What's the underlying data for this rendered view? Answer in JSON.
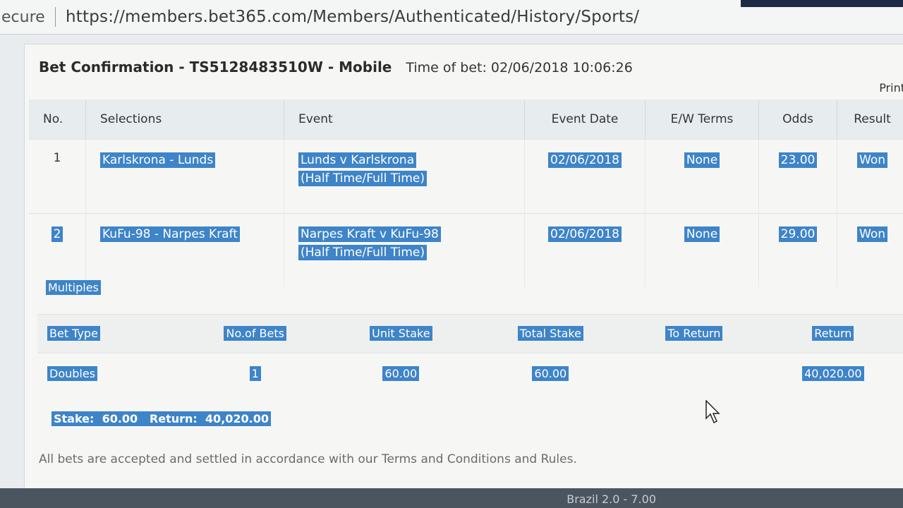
{
  "browser": {
    "secure_label": "ecure",
    "url": "https://members.bet365.com/Members/Authenticated/History/Sports/"
  },
  "header": {
    "title": "Bet Confirmation - TS5128483510W - Mobile",
    "time_of_bet": "Time of bet: 02/06/2018 10:06:26",
    "print_label": "Print"
  },
  "selections_table": {
    "columns": [
      "No.",
      "Selections",
      "Event",
      "Event Date",
      "E/W Terms",
      "Odds",
      "Result"
    ],
    "rows": [
      {
        "no": "1",
        "selection": "Karlskrona - Lunds",
        "event_line1": "Lunds v Karlskrona",
        "event_line2": "(Half Time/Full Time)",
        "event_date": "02/06/2018",
        "ew_terms": "None",
        "odds": "23.00",
        "result": "Won"
      },
      {
        "no": "2",
        "selection": "KuFu-98 - Narpes Kraft",
        "event_line1": "Narpes Kraft v KuFu-98",
        "event_line2": "(Half Time/Full Time)",
        "event_date": "02/06/2018",
        "ew_terms": "None",
        "odds": "29.00",
        "result": "Won"
      }
    ]
  },
  "multiples": {
    "label": "Multiples",
    "columns": [
      "Bet Type",
      "No.of Bets",
      "Unit Stake",
      "Total Stake",
      "To Return",
      "Return"
    ],
    "row": {
      "bet_type": "Doubles",
      "no_of_bets": "1",
      "unit_stake": "60.00",
      "total_stake": "60.00",
      "to_return": "",
      "return": "40,020.00"
    }
  },
  "summary": "Stake:  60.00   Return:  40,020.00",
  "footer": "All bets are accepted and settled in accordance with our Terms and Conditions and Rules.",
  "bottom_partial_text": "Brazil 2.0 - 7.00",
  "colors": {
    "highlight": "#3e84c8",
    "panel": "#f6f7f5"
  }
}
